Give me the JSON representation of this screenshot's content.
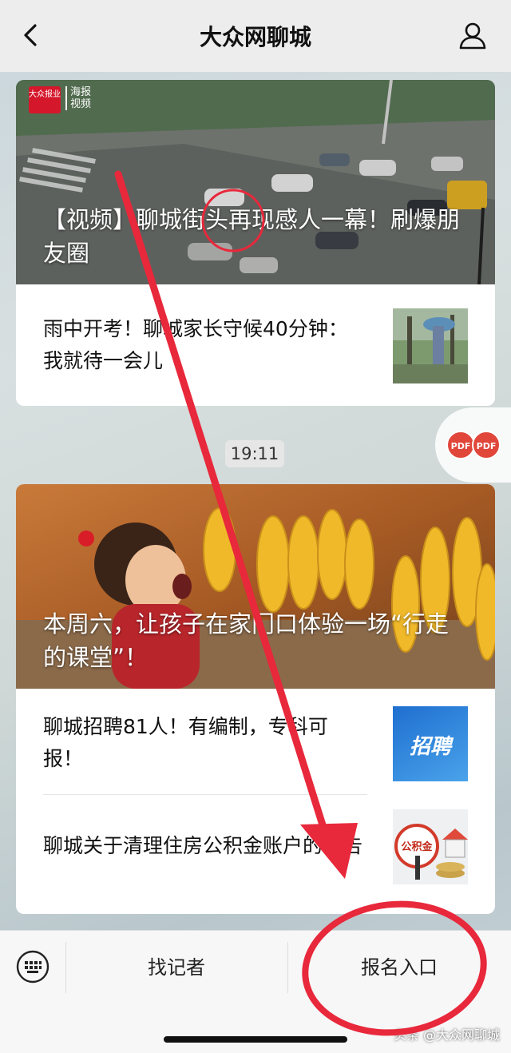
{
  "nav": {
    "title": "大众网聊城"
  },
  "card1": {
    "hero_logo_text": "大众报业",
    "hero_tag": "海报视频",
    "hero_caption": "【视频】聊城街头再现感人一幕！刷爆朋友圈",
    "items": [
      {
        "text": "雨中开考！聊城家长守候40分钟：我就待一会儿",
        "thumb_icon": "umbrella-person-photo"
      }
    ]
  },
  "time_label": "19:11",
  "pdf_badges": [
    "PDF",
    "PDF"
  ],
  "card2": {
    "hero_caption": "本周六，让孩子在家门口体验一场“行走的课堂”！",
    "items": [
      {
        "text": "聊城招聘81人！有编制，专科可报！",
        "thumb_label": "招聘"
      },
      {
        "text": "聊城关于清理住房公积金账户的公告",
        "thumb_label": "公积金"
      }
    ]
  },
  "bottom_menu": {
    "keyboard_icon": "keyboard-icon",
    "item1": "找记者",
    "item2": "报名入口"
  },
  "watermark": "头条 @大众网聊城",
  "annotation_colors": {
    "arrow": "#e8283b",
    "circle": "#e8283b"
  }
}
